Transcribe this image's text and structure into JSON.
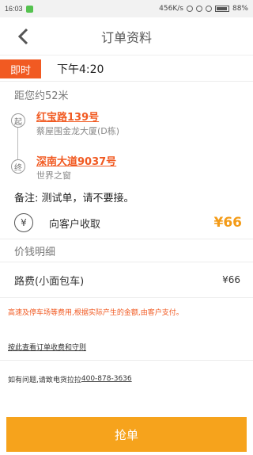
{
  "status_bar": {
    "time": "16:03",
    "network": "456K/s",
    "battery": "88%"
  },
  "nav": {
    "title": "订单资料"
  },
  "order": {
    "type_badge": "即时",
    "time": "下午4:20",
    "distance": "距您约52米",
    "start": {
      "marker": "起",
      "address": "红宝路139号",
      "detail": "蔡屋围金龙大厦(D栋)"
    },
    "end": {
      "marker": "终",
      "address": "深南大道9037号",
      "detail": "世界之窗"
    },
    "remark": "备注: 测试单，请不要接。",
    "payment": {
      "icon": "¥",
      "label": "向客户收取",
      "amount": "¥66"
    }
  },
  "price_detail": {
    "title": "价钱明细",
    "items": [
      {
        "label": "路费(小面包车)",
        "amount": "¥66"
      }
    ]
  },
  "notice": "高速及停车场等费用,根据实际产生的金额,由客户支付。",
  "link_text": "按此查看订单收费和守则",
  "help": {
    "text": "如有问题,请致电货拉拉",
    "phone": "400-878-3636"
  },
  "primary_button": "抢单",
  "colors": {
    "accent": "#f15a22",
    "amount": "#f39b18",
    "button": "#f6a31c"
  }
}
